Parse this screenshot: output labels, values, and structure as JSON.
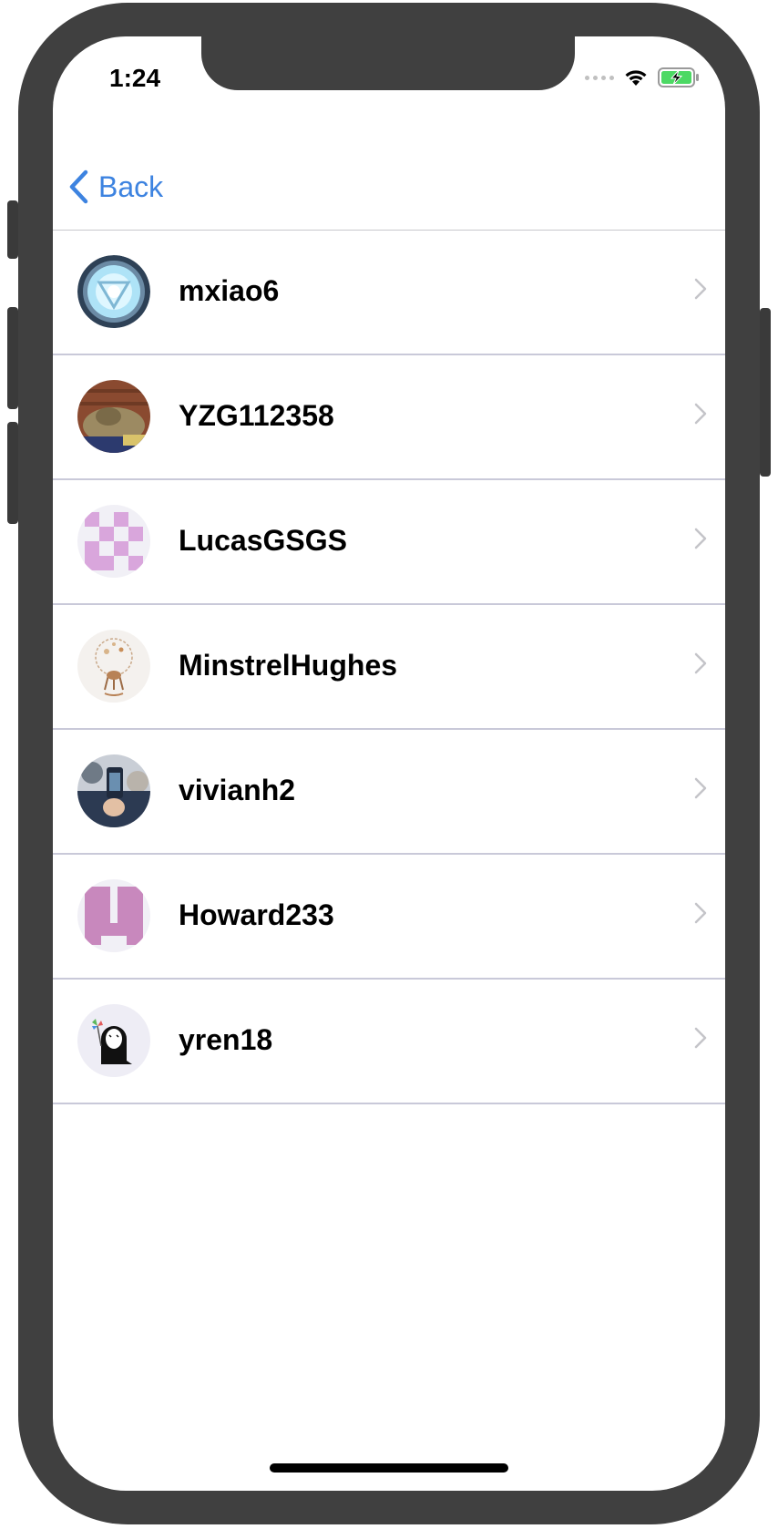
{
  "status_bar": {
    "time": "1:24",
    "battery_color": "#4cd964"
  },
  "nav": {
    "back_label": "Back",
    "back_icon": "chevron-left-icon",
    "accent_color": "#3d83e0"
  },
  "users": [
    {
      "name": "mxiao6",
      "avatar": "arc-reactor-avatar"
    },
    {
      "name": "YZG112358",
      "avatar": "cat-photo-avatar"
    },
    {
      "name": "LucasGSGS",
      "avatar": "pink-pattern-avatar"
    },
    {
      "name": "MinstrelHughes",
      "avatar": "deer-illustration-avatar"
    },
    {
      "name": "vivianh2",
      "avatar": "photo-hand-avatar"
    },
    {
      "name": "Howard233",
      "avatar": "pink-block-avatar"
    },
    {
      "name": "yren18",
      "avatar": "ghost-pinwheel-avatar"
    }
  ],
  "row_chevron_icon": "chevron-right-icon"
}
